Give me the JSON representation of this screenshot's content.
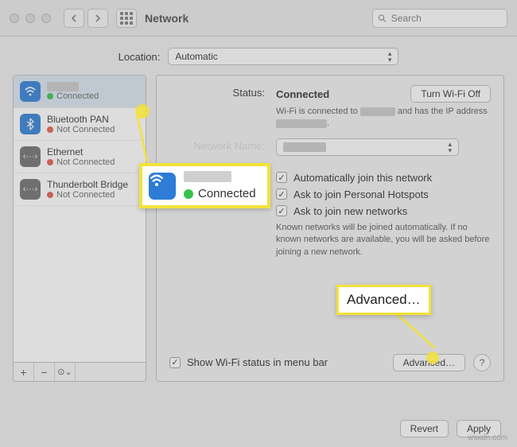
{
  "window": {
    "title": "Network"
  },
  "search": {
    "placeholder": "Search"
  },
  "location": {
    "label": "Location:",
    "value": "Automatic"
  },
  "sidebar": {
    "items": [
      {
        "name_hidden": true,
        "status": "Connected",
        "status_color": "green",
        "icon": "wifi"
      },
      {
        "name": "Bluetooth PAN",
        "status": "Not Connected",
        "status_color": "red",
        "icon": "bt"
      },
      {
        "name": "Ethernet",
        "status": "Not Connected",
        "status_color": "red",
        "icon": "eth"
      },
      {
        "name": "Thunderbolt Bridge",
        "status": "Not Connected",
        "status_color": "red",
        "icon": "tb"
      }
    ],
    "foot": {
      "add": "+",
      "remove": "−",
      "menu": "☉⌄"
    }
  },
  "detail": {
    "status_label": "Status:",
    "status_value": "Connected",
    "wifi_off_btn": "Turn Wi-Fi Off",
    "status_note_pre": "Wi-Fi is connected to ",
    "status_note_mid": " and has the IP address ",
    "status_note_end": ".",
    "network_label": "Network Name:",
    "auto_join": "Automatically join this network",
    "ask_hotspot": "Ask to join Personal Hotspots",
    "ask_new": "Ask to join new networks",
    "known_note": "Known networks will be joined automatically. If no known networks are available, you will be asked before joining a new network.",
    "show_menu": "Show Wi-Fi status in menu bar",
    "advanced_btn": "Advanced…",
    "help": "?"
  },
  "callouts": {
    "big_status": "Connected",
    "adv": "Advanced…"
  },
  "footer": {
    "revert": "Revert",
    "apply": "Apply"
  },
  "watermark": "wsxdn.com"
}
